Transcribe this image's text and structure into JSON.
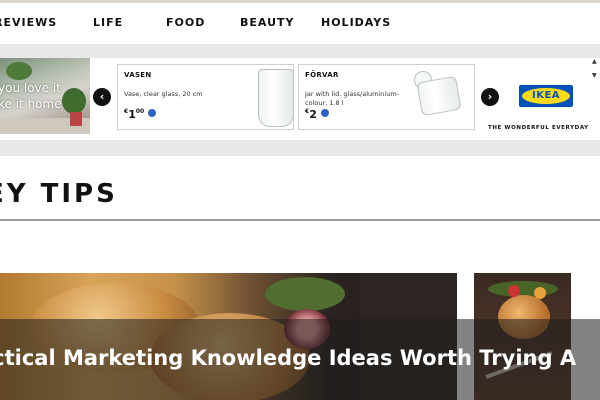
{
  "nav": {
    "items": [
      "REVIEWS",
      "LIFE",
      "FOOD",
      "BEAUTY",
      "HOLIDAYS"
    ]
  },
  "ad": {
    "photo_tagline": "you love it\nke it home",
    "cards": [
      {
        "name": "VASEN",
        "desc": "Vase, clear glass, 20 cm",
        "price": "1",
        "price_sup": "00"
      },
      {
        "name": "FÖRVAR",
        "desc": "Jar with lid, glass/aluminium-colour, 1.8 l",
        "price": "2",
        "price_sup": ""
      }
    ],
    "prev_icon": "chevron-left-icon",
    "next_icon": "chevron-right-icon",
    "logo_text": "IKEA",
    "slogan": "THE WONDERFUL EVERYDAY",
    "logo_colors": {
      "blue": "#0051ba",
      "yellow": "#ffda1a"
    }
  },
  "section": {
    "title": "EY TIPS"
  },
  "feature": {
    "caption": "actical Marketing Knowledge Ideas Worth Trying A"
  }
}
